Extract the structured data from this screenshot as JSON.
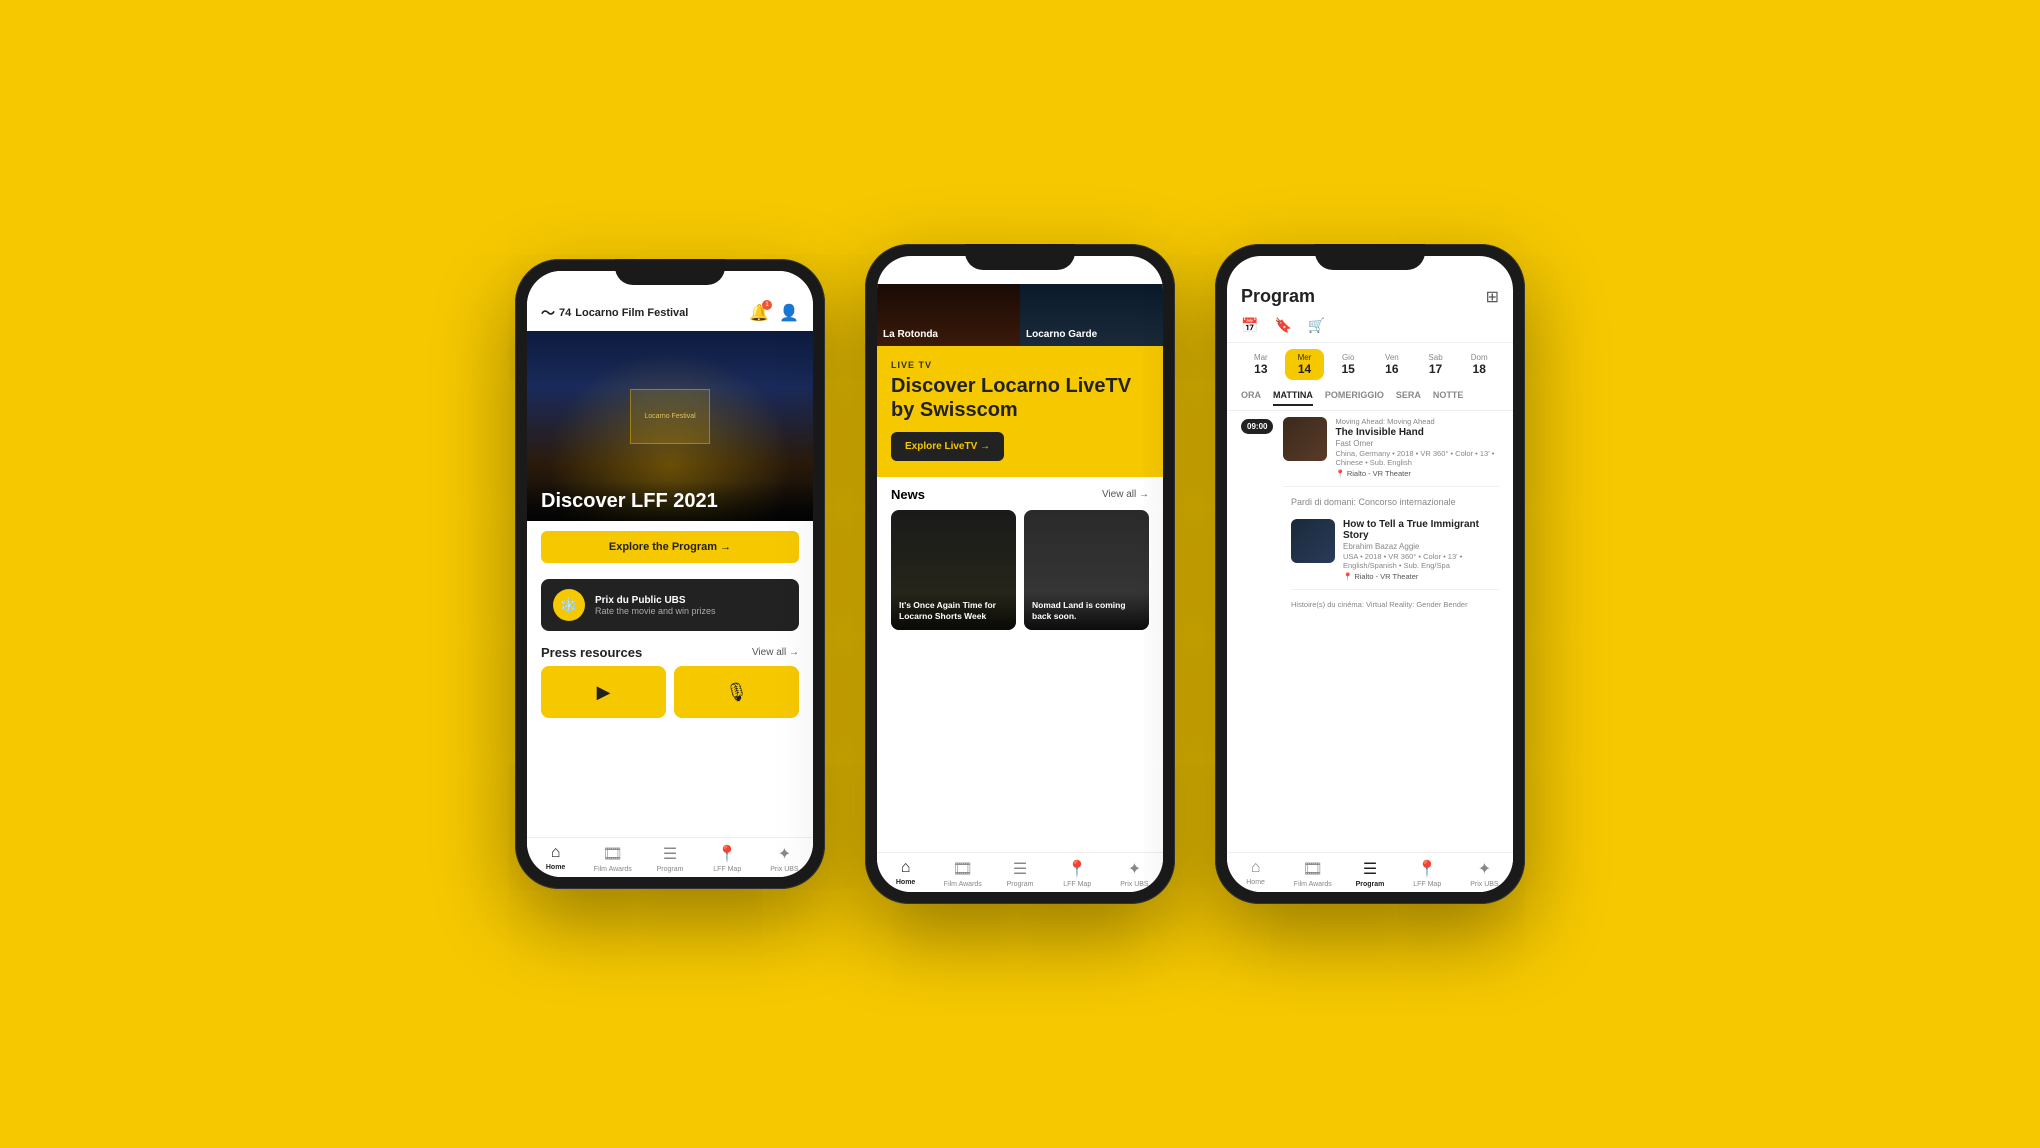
{
  "background_color": "#F5C800",
  "phone1": {
    "header": {
      "logo_number": "74",
      "logo_text": "Locarno Film Festival",
      "notification_count": "1"
    },
    "hero": {
      "screen_text": "Locarno Festival",
      "title": "Discover LFF 2021"
    },
    "cta_button": "Explore the Program →",
    "banner": {
      "title": "Prix du Public UBS",
      "subtitle": "Rate the movie and win prizes"
    },
    "press_section": {
      "title": "Press resources",
      "view_all": "View all →"
    },
    "nav": {
      "items": [
        {
          "label": "Home",
          "active": true
        },
        {
          "label": "Film Awards",
          "active": false
        },
        {
          "label": "Program",
          "active": false
        },
        {
          "label": "LFF Map",
          "active": false
        },
        {
          "label": "Prix UBS",
          "active": false
        }
      ]
    }
  },
  "phone2": {
    "venues": [
      {
        "label": "La Rotonda"
      },
      {
        "label": "Locarno Garde"
      }
    ],
    "live_section": {
      "tag": "LIVE TV",
      "title": "Discover Locarno LiveTV by Swisscom",
      "cta": "Explore LiveTV →"
    },
    "news_section": {
      "title": "News",
      "view_all": "View all →",
      "cards": [
        {
          "text": "It's Once Again Time for Locarno Shorts Week"
        },
        {
          "text": "Nomad Land is coming back soon."
        }
      ]
    },
    "nav": {
      "items": [
        {
          "label": "Home",
          "active": true
        },
        {
          "label": "Film Awards",
          "active": false
        },
        {
          "label": "Program",
          "active": false
        },
        {
          "label": "LFF Map",
          "active": false
        },
        {
          "label": "Prix UBS",
          "active": false
        }
      ]
    }
  },
  "phone3": {
    "title": "Program",
    "tabs": [
      {
        "icon": "📅",
        "active": true
      },
      {
        "icon": "🔖",
        "active": false
      },
      {
        "icon": "🛒",
        "active": false
      }
    ],
    "days": [
      {
        "name": "Mar",
        "num": "13",
        "active": false
      },
      {
        "name": "Mer",
        "num": "14",
        "active": true
      },
      {
        "name": "Gio",
        "num": "15",
        "active": false
      },
      {
        "name": "Ven",
        "num": "16",
        "active": false
      },
      {
        "name": "Sab",
        "num": "17",
        "active": false
      },
      {
        "name": "Dom",
        "num": "18",
        "active": false
      }
    ],
    "time_filters": [
      {
        "label": "ORA",
        "active": false
      },
      {
        "label": "MATTINA",
        "active": true
      },
      {
        "label": "POMERIGGIO",
        "active": false
      },
      {
        "label": "SERA",
        "active": false
      },
      {
        "label": "NOTTE",
        "active": false
      }
    ],
    "schedule": [
      {
        "time": "09:00",
        "events": [
          {
            "category": "Moving Ahead: Moving Ahead",
            "title": "The Invisible Hand",
            "subtitle": "Fast Omer",
            "meta": "China, Germany • 2018 • VR 360° • Color • 13' • Chinese • Sub. English",
            "location": "Rialto - VR Theater",
            "has_thumb": true,
            "thumb_class": "thumb-bg1"
          }
        ]
      },
      {
        "time": "",
        "events": [
          {
            "category": "Pardi di domani: Concorso internazionale",
            "title": "How to Tell a True Immigrant Story",
            "subtitle": "Ebrahim Bazaz Aggie",
            "meta": "USA • 2018 • VR 360° • Color • 13' • English/Spanish • Sub. Eng/Spa",
            "location": "Rialto - VR Theater",
            "has_thumb": true,
            "thumb_class": "thumb-bg2"
          }
        ]
      },
      {
        "time": "",
        "events": [
          {
            "category": "Histoire(s) du cinéma: Virtual Reality: Gender Bender",
            "title": "",
            "subtitle": "",
            "meta": "",
            "location": "",
            "has_thumb": false,
            "thumb_class": ""
          }
        ]
      }
    ],
    "nav": {
      "items": [
        {
          "label": "Home",
          "active": false
        },
        {
          "label": "Film Awards",
          "active": false
        },
        {
          "label": "Program",
          "active": true
        },
        {
          "label": "LFF Map",
          "active": false
        },
        {
          "label": "Prix UBS",
          "active": false
        }
      ]
    }
  }
}
